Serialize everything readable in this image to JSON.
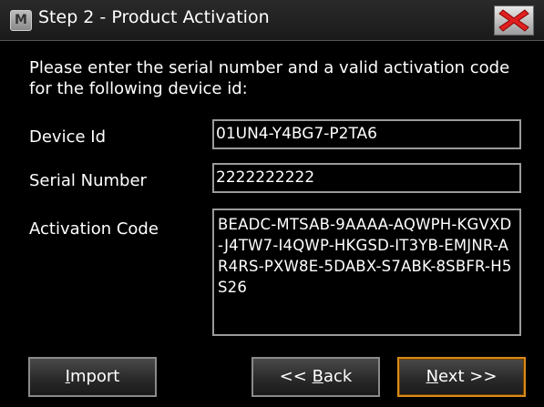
{
  "window": {
    "app_icon_letter": "M",
    "title": "Step 2 - Product Activation",
    "close_icon": "close-x-icon",
    "close_color": "#e02020"
  },
  "instructions": "Please enter the serial number and a valid activation code for the following device id:",
  "fields": {
    "device_id": {
      "label": "Device Id",
      "value": "01UN4-Y4BG7-P2TA6"
    },
    "serial_number": {
      "label": "Serial Number",
      "value": "2222222222"
    },
    "activation_code": {
      "label": "Activation Code",
      "value": "BEADC-MTSAB-9AAAA-AQWPH-KGVXD-J4TW7-I4QWP-HKGSD-IT3YB-EMJNR-AR4RS-PXW8E-5DABX-S7ABK-8SBFR-H5S26"
    }
  },
  "buttons": {
    "import": {
      "mnemonic": "I",
      "rest": "mport"
    },
    "back": {
      "prefix": "<< ",
      "mnemonic": "B",
      "rest": "ack"
    },
    "next": {
      "mnemonic": "N",
      "rest": "ext >>"
    }
  },
  "colors": {
    "background": "#000000",
    "focus_border": "#d88a1a",
    "field_border": "#9a9a9a"
  }
}
